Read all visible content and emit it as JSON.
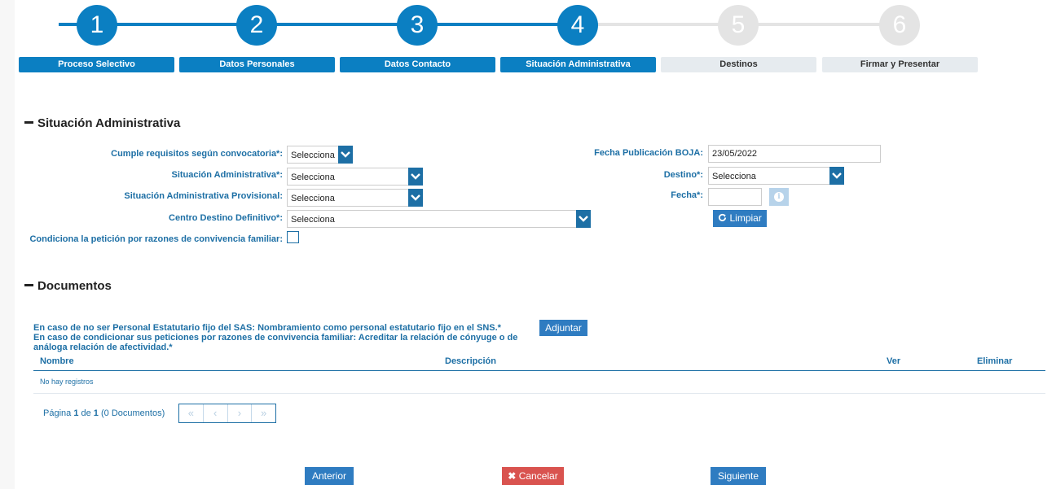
{
  "steps": [
    {
      "number": "1",
      "label": "Proceso Selectivo",
      "state": "done"
    },
    {
      "number": "2",
      "label": "Datos Personales",
      "state": "done"
    },
    {
      "number": "3",
      "label": "Datos Contacto",
      "state": "done"
    },
    {
      "number": "4",
      "label": "Situación Administrativa",
      "state": "current"
    },
    {
      "number": "5",
      "label": "Destinos",
      "state": "pending"
    },
    {
      "number": "6",
      "label": "Firmar y Presentar",
      "state": "pending"
    }
  ],
  "colors": {
    "accent": "#0b7fc2",
    "inactive": "#e4e4e4",
    "label": "#1d6fa5",
    "danger": "#d9534f"
  },
  "situacion": {
    "title": "Situación Administrativa",
    "cumple_label": "Cumple requisitos según convocatoria*:",
    "cumple_value": "Selecciona",
    "situacion_label": "Situación Administrativa*:",
    "situacion_value": "Selecciona",
    "provisional_label": "Situación Administrativa Provisional:",
    "provisional_value": "Selecciona",
    "centro_label": "Centro Destino Definitivo*:",
    "centro_value": "Selecciona",
    "condiciona_label": "Condiciona la petición por razones de convivencia familiar:",
    "condiciona_checked": false,
    "fecha_boja_label": "Fecha Publicación BOJA:",
    "fecha_boja_value": "23/05/2022",
    "destino_label": "Destino*:",
    "destino_value": "Selecciona",
    "fecha_label": "Fecha*:",
    "fecha_value": "",
    "info_icon": "info-icon",
    "limpiar_label": "Limpiar",
    "limpiar_icon": "refresh-icon"
  },
  "documentos": {
    "title": "Documentos",
    "req1": "En caso de no ser Personal Estatutario fijo del SAS: Nombramiento como personal estatutario fijo en el SNS.*",
    "req2a": "En caso de condicionar sus peticiones por razones de convivencia familiar: Acreditar la relación de cónyuge o de",
    "req2b": "análoga relación de afectividad.*",
    "adjuntar_label": "Adjuntar",
    "columns": [
      "Nombre",
      "Descripción",
      "Ver",
      "Eliminar"
    ],
    "empty_text": "No hay registros",
    "pager": {
      "prefix": "Página ",
      "page": "1",
      "mid": " de ",
      "total": "1",
      "suffix": " (0 Documentos)"
    }
  },
  "footer": {
    "anterior_label": "Anterior",
    "cancelar_label": "Cancelar",
    "cancelar_icon": "close-icon",
    "siguiente_label": "Siguiente"
  }
}
